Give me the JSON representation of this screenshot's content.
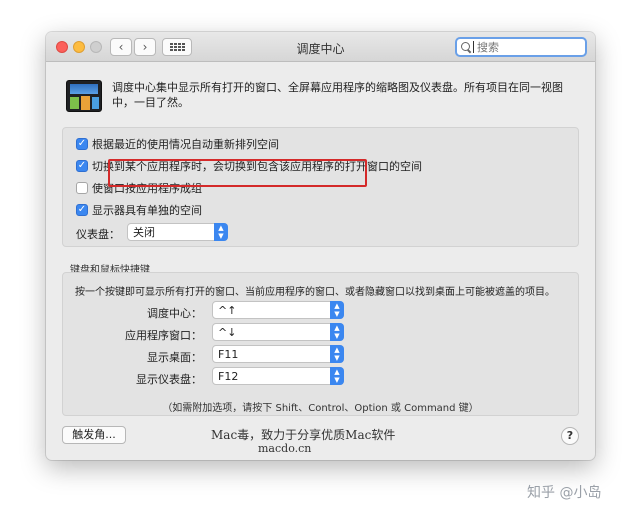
{
  "window": {
    "title": "调度中心",
    "search_placeholder": "搜索"
  },
  "description": "调度中心集中显示所有打开的窗口、全屏幕应用程序的缩略图及仪表盘。所有项目在同一视图中，一目了然。",
  "options": [
    {
      "label": "根据最近的使用情况自动重新排列空间",
      "checked": true
    },
    {
      "label": "切换到某个应用程序时，会切换到包含该应用程序的打开窗口的空间",
      "checked": true
    },
    {
      "label": "使窗口按应用程序成组",
      "checked": false
    },
    {
      "label": "显示器具有单独的空间",
      "checked": true
    }
  ],
  "dashboard": {
    "label": "仪表盘：",
    "value": "关闭"
  },
  "shortcuts": {
    "title": "键盘和鼠标快捷键",
    "intro": "按一个按键即可显示所有打开的窗口、当前应用程序的窗口、或者隐藏窗口以找到桌面上可能被遮盖的项目。",
    "rows": [
      {
        "label": "调度中心：",
        "value": "^↑"
      },
      {
        "label": "应用程序窗口：",
        "value": "^↓"
      },
      {
        "label": "显示桌面：",
        "value": "F11"
      },
      {
        "label": "显示仪表盘：",
        "value": "F12"
      }
    ],
    "hint": "（如需附加选项，请按下 Shift、Control、Option 或 Command 键）"
  },
  "buttons": {
    "hot_corners": "触发角...",
    "help": "?"
  },
  "watermark": {
    "line1": "Mac毒，致力于分享优质Mac软件",
    "line2": "macdo.cn",
    "corner": "知乎 @小岛"
  },
  "colors": {
    "accent": "#3b87f0",
    "highlight": "#d42a2a"
  }
}
